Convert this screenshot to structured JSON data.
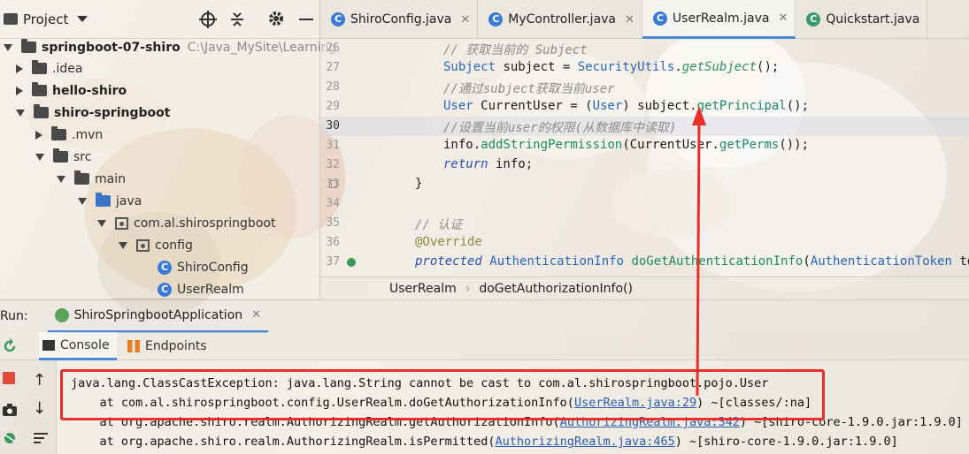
{
  "project": {
    "title": "Project",
    "tree": [
      {
        "label": "springboot-07-shiro",
        "hint": "C:\\Java_MySite\\Learning",
        "expanded": true,
        "kind": "module"
      },
      {
        "label": ".idea",
        "expanded": false,
        "kind": "folder"
      },
      {
        "label": "hello-shiro",
        "expanded": false,
        "kind": "module"
      },
      {
        "label": "shiro-springboot",
        "expanded": true,
        "kind": "module"
      },
      {
        "label": ".mvn",
        "expanded": false,
        "kind": "folder"
      },
      {
        "label": "src",
        "expanded": true,
        "kind": "folder"
      },
      {
        "label": "main",
        "expanded": true,
        "kind": "folder"
      },
      {
        "label": "java",
        "expanded": true,
        "kind": "source-folder"
      },
      {
        "label": "com.al.shirospringboot",
        "expanded": true,
        "kind": "package"
      },
      {
        "label": "config",
        "expanded": true,
        "kind": "package"
      },
      {
        "label": "ShiroConfig",
        "kind": "class"
      },
      {
        "label": "UserRealm",
        "kind": "class"
      }
    ]
  },
  "tabs": [
    {
      "label": "ShiroConfig.java",
      "active": false
    },
    {
      "label": "MyController.java",
      "active": false
    },
    {
      "label": "UserRealm.java",
      "active": true
    },
    {
      "label": "Quickstart.java",
      "active": false
    }
  ],
  "editor": {
    "lines": [
      {
        "n": "26",
        "text": "// 获取当前的 Subject"
      },
      {
        "n": "27",
        "text": "Subject subject = SecurityUtils.getSubject();"
      },
      {
        "n": "28",
        "text": "//通过subject获取当前user"
      },
      {
        "n": "29",
        "text": "User CurrentUser = (User) subject.getPrincipal();"
      },
      {
        "n": "30",
        "text": "//设置当前user的权限(从数据库中读取)"
      },
      {
        "n": "31",
        "text": "info.addStringPermission(CurrentUser.getPerms());"
      },
      {
        "n": "32",
        "text": "return info;"
      },
      {
        "n": "33",
        "text": "}"
      },
      {
        "n": "34",
        "text": ""
      },
      {
        "n": "35",
        "text": "// 认证"
      },
      {
        "n": "36",
        "text": "@Override"
      },
      {
        "n": "37",
        "text": "protected AuthenticationInfo doGetAuthenticationInfo(AuthenticationToken token"
      }
    ]
  },
  "breadcrumb": [
    "UserRealm",
    "doGetAuthorizationInfo()"
  ],
  "run": {
    "label": "Run:",
    "config": "ShiroSpringbootApplication",
    "console_tab": "Console",
    "endpoints_tab": "Endpoints"
  },
  "console": {
    "lines": [
      {
        "pre": "java.lang.ClassCastException: java.lang.String cannot be cast to com.al.shirospringboot.pojo.User",
        "link": "",
        "post": ""
      },
      {
        "pre": "    at com.al.shirospringboot.config.UserRealm.doGetAuthorizationInfo(",
        "link": "UserRealm.java:29",
        "post": ") ~[classes/:na]"
      },
      {
        "pre": "    at org.apache.shiro.realm.AuthorizingRealm.getAuthorizationInfo(",
        "link": "AuthorizingRealm.java:342",
        "post": ") ~[shiro-core-1.9.0.jar:1.9.0]"
      },
      {
        "pre": "    at org.apache.shiro.realm.AuthorizingRealm.isPermitted(",
        "link": "AuthorizingRealm.java:465",
        "post": ") ~[shiro-core-1.9.0.jar:1.9.0]"
      }
    ]
  },
  "colors": {
    "highlight_box": "#e8302a",
    "arrow": "#e8302a",
    "active_tab": "#4a86d9"
  }
}
